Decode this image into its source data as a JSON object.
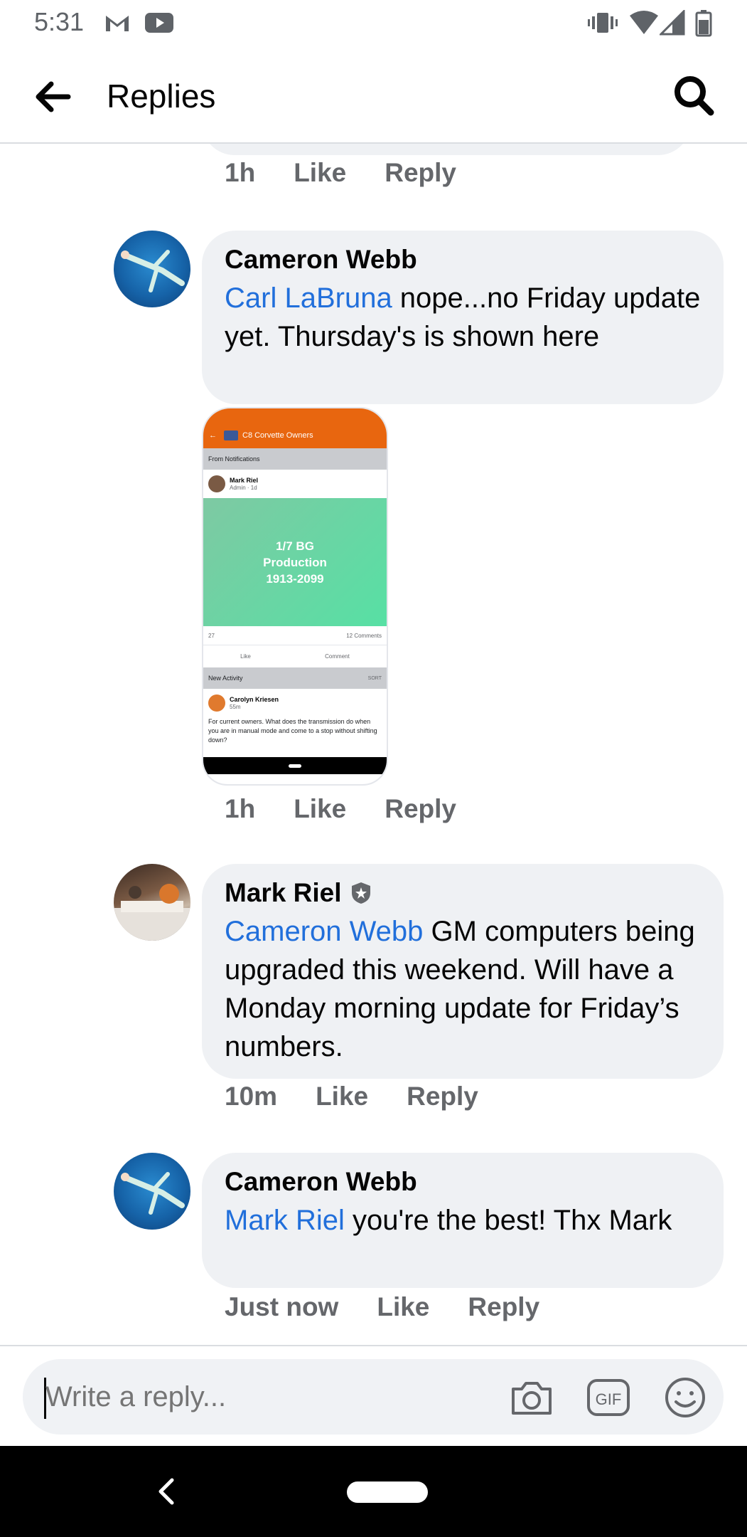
{
  "status_bar": {
    "time": "5:31",
    "icons": [
      "gmail-icon",
      "youtube-icon",
      "vibrate-icon",
      "wifi-icon",
      "signal-icon",
      "battery-icon"
    ]
  },
  "header": {
    "title": "Replies",
    "back_icon": "arrow-left-icon",
    "search_icon": "search-icon"
  },
  "previous_comment_meta": {
    "time": "1h",
    "like": "Like",
    "reply": "Reply"
  },
  "comments": [
    {
      "author": "Cameron Webb",
      "mention": "Carl LaBruna",
      "text": " nope...no Friday update yet.  Thursday's is shown here",
      "time": "1h",
      "like": "Like",
      "reply": "Reply",
      "attachment": {
        "group_name": "C8 Corvette Owners",
        "section_label": "From Notifications",
        "post_author": "Mark Riel",
        "post_meta": "Admin · 1d",
        "green_text_line1": "1/7 BG",
        "green_text_line2": "Production",
        "green_text_line3": "1913-2099",
        "reactions": "27",
        "comments_count": "12 Comments",
        "like": "Like",
        "comment": "Comment",
        "section2_label": "New Activity",
        "sort": "SORT",
        "post2_author": "Carolyn Kriesen",
        "post2_meta": "55m",
        "post2_text": "For current owners. What does the transmission do when you are in manual mode and come to a stop without shifting down?"
      }
    },
    {
      "author": "Mark Riel",
      "badge_icon": "admin-shield-icon",
      "mention": "Cameron Webb",
      "text": " GM computers being upgraded this weekend. Will have a Monday morning update for Friday’s numbers.",
      "time": "10m",
      "like": "Like",
      "reply": "Reply"
    },
    {
      "author": "Cameron Webb",
      "mention": "Mark Riel",
      "text": " you're the best!  Thx Mark",
      "time": "Just now",
      "like": "Like",
      "reply": "Reply"
    }
  ],
  "composer": {
    "placeholder": "Write a reply...",
    "icons": [
      "camera-icon",
      "gif-icon",
      "emoji-icon"
    ]
  },
  "colors": {
    "mention": "#216fdb",
    "bubble": "#eff1f4",
    "meta": "#65676b"
  }
}
